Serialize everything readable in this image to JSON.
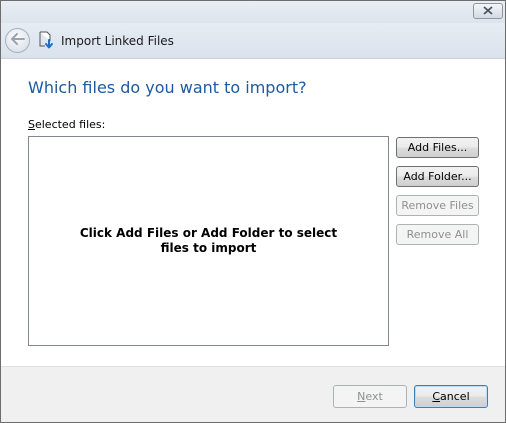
{
  "window": {
    "close_icon": "close-icon"
  },
  "nav": {
    "back_icon": "back-arrow-icon",
    "title_icon": "linked-file-icon",
    "title": "Import Linked Files"
  },
  "main": {
    "heading": "Which files do you want to import?",
    "selected_label_access_key": "S",
    "selected_label_rest": "elected files:",
    "empty_message": "Click Add Files or Add Folder to select files to import"
  },
  "side_buttons": {
    "add_files": "Add Files...",
    "add_folder": "Add Folder...",
    "remove_files": "Remove Files",
    "remove_all": "Remove All"
  },
  "footer": {
    "next_access_key": "N",
    "next_rest": "ext",
    "cancel_access_key": "C",
    "cancel_rest": "ancel"
  },
  "colors": {
    "heading": "#1e5aa0",
    "footer_bg": "#f0f0f0"
  }
}
